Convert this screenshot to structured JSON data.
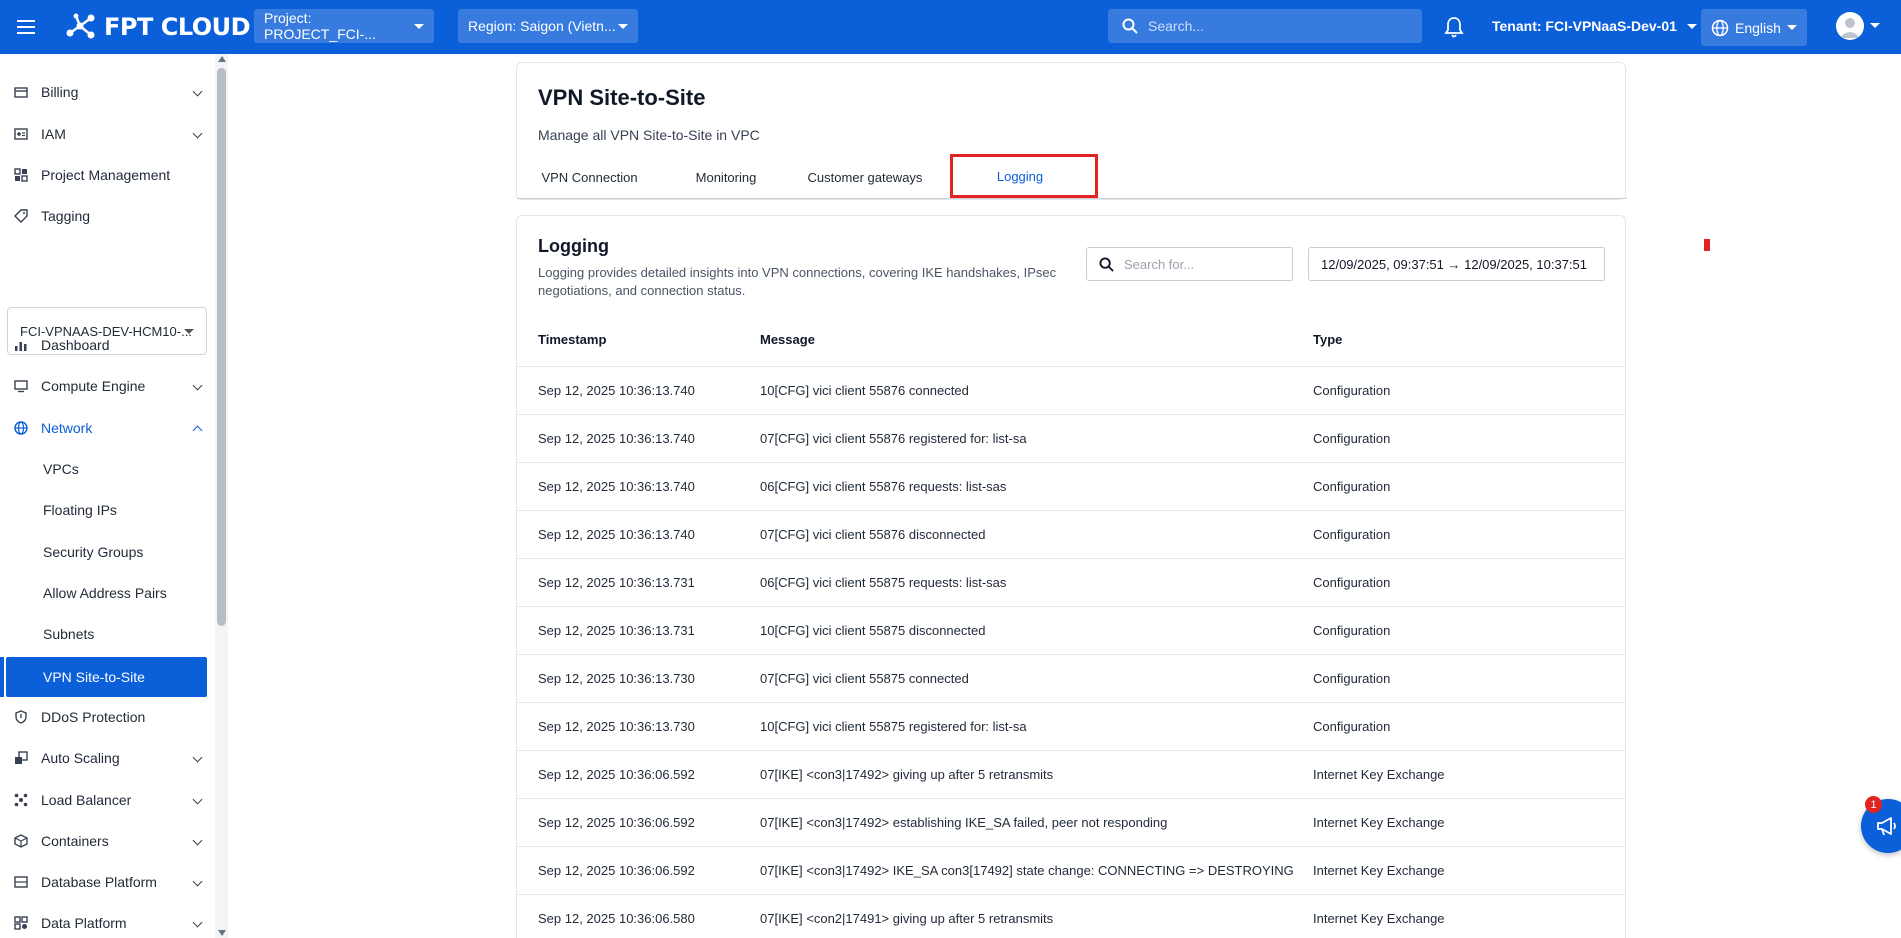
{
  "topbar": {
    "logo_text": "FPT CLOUD",
    "project": "Project: PROJECT_FCI-...",
    "region": "Region: Saigon (Vietn...",
    "search_placeholder": "Search...",
    "tenant": "Tenant: FCI-VPNaaS-Dev-01",
    "language": "English",
    "brand_color": "#0b5fd8"
  },
  "sidebar": {
    "top_items": [
      {
        "label": "Billing",
        "icon": "billing-icon"
      },
      {
        "label": "IAM",
        "icon": "iam-icon"
      },
      {
        "label": "Project Management",
        "icon": "project-management-icon"
      },
      {
        "label": "Tagging",
        "icon": "tag-icon"
      }
    ],
    "project_select": "FCI-VPNAAS-DEV-HCM10-...",
    "items": [
      {
        "label": "Dashboard",
        "icon": "dashboard-icon"
      },
      {
        "label": "Compute Engine",
        "icon": "compute-icon"
      },
      {
        "label": "Network",
        "icon": "network-icon"
      },
      {
        "label": "DDoS Protection",
        "icon": "ddos-icon"
      },
      {
        "label": "Auto Scaling",
        "icon": "auto-scaling-icon"
      },
      {
        "label": "Load Balancer",
        "icon": "load-balancer-icon"
      },
      {
        "label": "Containers",
        "icon": "containers-icon"
      },
      {
        "label": "Database Platform",
        "icon": "database-icon"
      },
      {
        "label": "Data Platform",
        "icon": "data-platform-icon"
      }
    ],
    "network_sub": [
      "VPCs",
      "Floating IPs",
      "Security Groups",
      "Allow Address Pairs",
      "Subnets",
      "VPN Site-to-Site"
    ]
  },
  "header": {
    "title": "VPN Site-to-Site",
    "subtitle": "Manage all VPN Site-to-Site in VPC",
    "tabs": [
      "VPN Connection",
      "Monitoring",
      "Customer gateways",
      "Logging"
    ],
    "active_tab": "Logging"
  },
  "logging": {
    "title": "Logging",
    "description": "Logging provides detailed insights into VPN connections, covering IKE handshakes, IPsec negotiations, and connection status.",
    "search_placeholder": "Search for...",
    "date_range": "12/09/2025, 09:37:51 → 12/09/2025, 10:37:51",
    "columns": [
      "Timestamp",
      "Message",
      "Type"
    ],
    "rows": [
      [
        "Sep 12, 2025 10:36:13.740",
        "10[CFG] vici client 55876 connected",
        "Configuration"
      ],
      [
        "Sep 12, 2025 10:36:13.740",
        "07[CFG] vici client 55876 registered for: list-sa",
        "Configuration"
      ],
      [
        "Sep 12, 2025 10:36:13.740",
        "06[CFG] vici client 55876 requests: list-sas",
        "Configuration"
      ],
      [
        "Sep 12, 2025 10:36:13.740",
        "07[CFG] vici client 55876 disconnected",
        "Configuration"
      ],
      [
        "Sep 12, 2025 10:36:13.731",
        "06[CFG] vici client 55875 requests: list-sas",
        "Configuration"
      ],
      [
        "Sep 12, 2025 10:36:13.731",
        "10[CFG] vici client 55875 disconnected",
        "Configuration"
      ],
      [
        "Sep 12, 2025 10:36:13.730",
        "07[CFG] vici client 55875 connected",
        "Configuration"
      ],
      [
        "Sep 12, 2025 10:36:13.730",
        "10[CFG] vici client 55875 registered for: list-sa",
        "Configuration"
      ],
      [
        "Sep 12, 2025 10:36:06.592",
        "07[IKE] <con3|17492> giving up after 5 retransmits",
        "Internet Key Exchange"
      ],
      [
        "Sep 12, 2025 10:36:06.592",
        "07[IKE] <con3|17492> establishing IKE_SA failed, peer not responding",
        "Internet Key Exchange"
      ],
      [
        "Sep 12, 2025 10:36:06.592",
        "07[IKE] <con3|17492> IKE_SA con3[17492] state change: CONNECTING => DESTROYING",
        "Internet Key Exchange"
      ],
      [
        "Sep 12, 2025 10:36:06.580",
        "07[IKE] <con2|17491> giving up after 5 retransmits",
        "Internet Key Exchange"
      ]
    ]
  },
  "fab": {
    "badge": "1",
    "icon": "megaphone-icon"
  }
}
